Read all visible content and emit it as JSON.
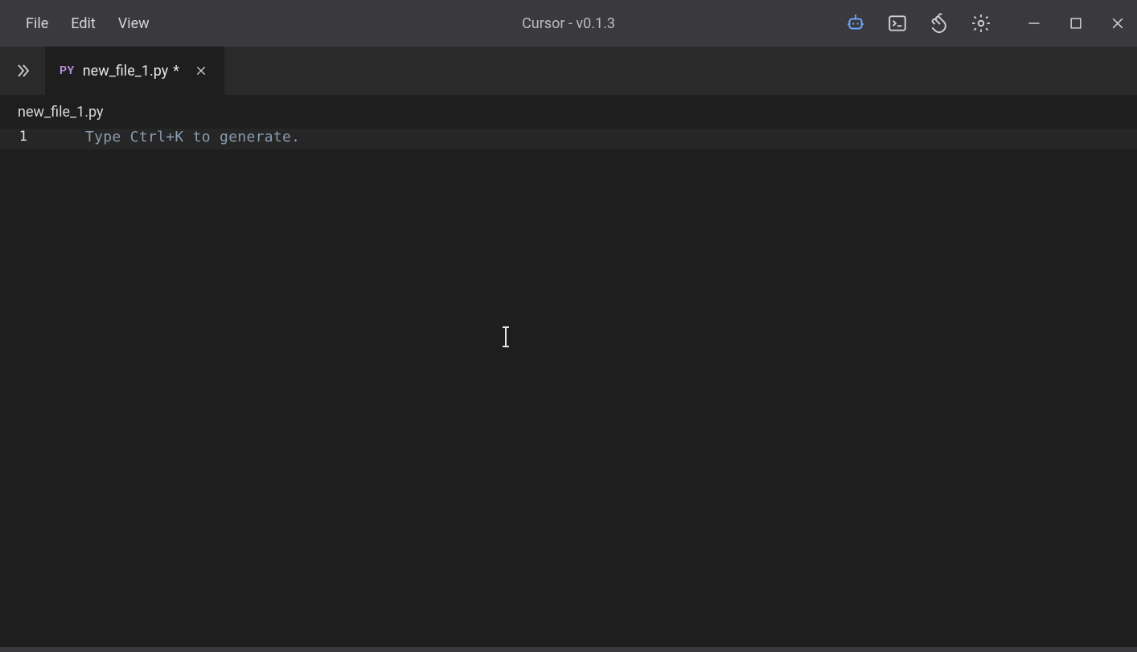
{
  "titlebar": {
    "menu": {
      "file": "File",
      "edit": "Edit",
      "view": "View"
    },
    "title": "Cursor - v0.1.3"
  },
  "tabs": {
    "active": {
      "filetype_badge": "PY",
      "name": "new_file_1.py",
      "dirty_marker": "*"
    }
  },
  "breadcrumb": {
    "path": "new_file_1.py"
  },
  "editor": {
    "lines": [
      {
        "num": "1",
        "text": "Type Ctrl+K to generate."
      }
    ]
  },
  "icons": {
    "bot": "bot-icon",
    "terminal": "terminal-icon",
    "wave": "wave-hand-icon",
    "settings": "gear-icon",
    "minimize": "minimize-icon",
    "maximize": "maximize-icon",
    "close_window": "close-window-icon",
    "expand_tabs": "chevrons-right-icon",
    "close_tab": "close-icon"
  }
}
